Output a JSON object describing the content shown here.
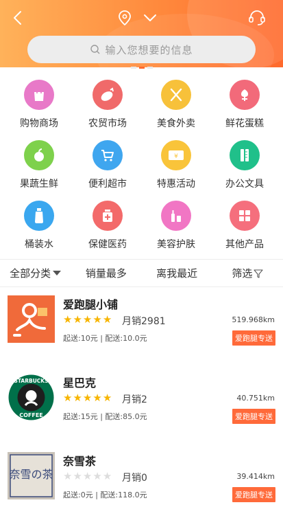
{
  "header": {
    "search_placeholder": "输入您想要的信息"
  },
  "categories": [
    {
      "label": "购物商场",
      "icon": "shopping-bag-icon",
      "color": "#e879c8"
    },
    {
      "label": "农贸市场",
      "icon": "eggplant-icon",
      "color": "#f06a6a"
    },
    {
      "label": "美食外卖",
      "icon": "cutlery-icon",
      "color": "#f7c13a"
    },
    {
      "label": "鲜花蛋糕",
      "icon": "flower-icon",
      "color": "#f26a7a"
    },
    {
      "label": "果蔬生鲜",
      "icon": "apple-icon",
      "color": "#7ed14c"
    },
    {
      "label": "便利超市",
      "icon": "cart-icon",
      "color": "#3fa6ef"
    },
    {
      "label": "特惠活动",
      "icon": "coupon-icon",
      "color": "#f9c43a"
    },
    {
      "label": "办公文具",
      "icon": "pencil-ruler-icon",
      "color": "#20c08a"
    },
    {
      "label": "桶装水",
      "icon": "water-bottle-icon",
      "color": "#3aa7ef"
    },
    {
      "label": "保健医药",
      "icon": "medicine-icon",
      "color": "#f36a6a"
    },
    {
      "label": "美容护肤",
      "icon": "cosmetics-icon",
      "color": "#f176c4"
    },
    {
      "label": "其他产品",
      "icon": "grid-icon",
      "color": "#f56f7d"
    }
  ],
  "filters": {
    "all": "全部分类",
    "sales": "销量最多",
    "nearest": "离我最近",
    "filter": "筛选"
  },
  "shops": [
    {
      "name": "爱跑腿小铺",
      "rating": 5,
      "sales": "月销2981",
      "fee": "起送:10元 | 配送:10.0元",
      "distance": "519.968km",
      "tag": "爱跑腿专送",
      "logo": "runner-logo"
    },
    {
      "name": "星巴克",
      "rating": 5,
      "sales": "月销2",
      "fee": "起送:15元 | 配送:85.0元",
      "distance": "40.751km",
      "tag": "爱跑腿专送",
      "logo": "starbucks-logo",
      "logo_text_top": "STARBUCKS",
      "logo_text_bottom": "COFFEE"
    },
    {
      "name": "奈雪茶",
      "rating": 0,
      "sales": "月销0",
      "fee": "起送:0元 | 配送:118.0元",
      "distance": "39.414km",
      "tag": "爱跑腿专送",
      "logo": "nayuki-logo",
      "logo_text": "奈雪の茶"
    }
  ],
  "colors": {
    "accent": "#ff6a2d",
    "star_on": "#f7b500",
    "star_off": "#dddddd"
  }
}
